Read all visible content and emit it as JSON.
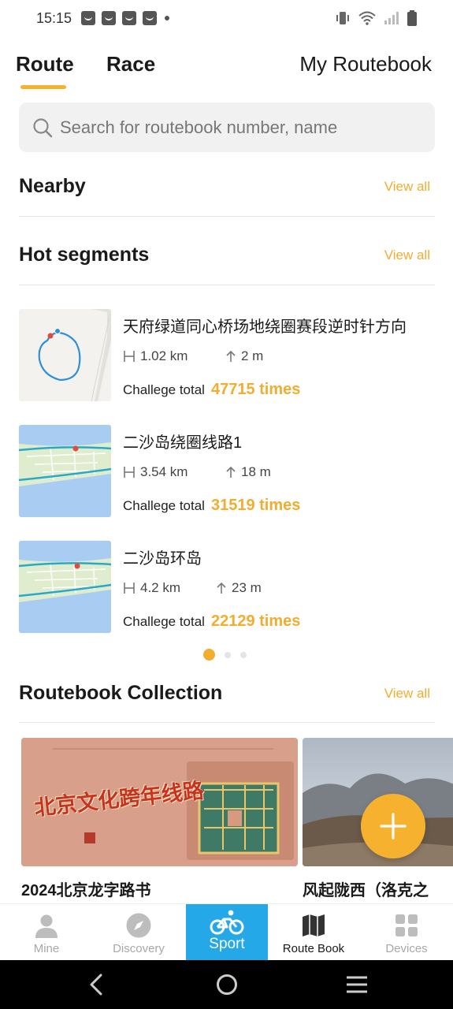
{
  "status_bar": {
    "time": "15:15",
    "notification_icons": [
      "bag-icon",
      "bag-icon",
      "bag-icon",
      "bag-icon"
    ],
    "icons": [
      "vibrate-icon",
      "wifi-icon",
      "signal-icon",
      "battery-icon"
    ]
  },
  "tabs": {
    "route": "Route",
    "race": "Race",
    "my_routebook": "My Routebook",
    "active": "Route"
  },
  "search": {
    "placeholder": "Search for routebook number, name"
  },
  "nearby": {
    "title": "Nearby",
    "view_all": "View all"
  },
  "hot_segments": {
    "title": "Hot segments",
    "view_all": "View all",
    "items": [
      {
        "name": "天府绿道同心桥场地绕圈赛段逆时针方向",
        "distance": "1.02 km",
        "climb": "2 m",
        "challenge_label": "Challege total",
        "challenge_value": "47715 times"
      },
      {
        "name": "二沙岛绕圈线路1",
        "distance": "3.54 km",
        "climb": "18 m",
        "challenge_label": "Challege total",
        "challenge_value": "31519 times"
      },
      {
        "name": "二沙岛环岛",
        "distance": "4.2 km",
        "climb": "23 m",
        "challenge_label": "Challege total",
        "challenge_value": "22129 times"
      }
    ],
    "pager": {
      "count": 3,
      "active": 1
    }
  },
  "routebook_collection": {
    "title": "Routebook Collection",
    "view_all": "View all",
    "cards": [
      {
        "title": "2024北京龙字路书",
        "banner_text": "北京文化跨年线路"
      },
      {
        "title": "风起陇西（洛克之"
      }
    ]
  },
  "fab": {
    "icon": "plus-icon"
  },
  "bottom_nav": {
    "items": [
      {
        "label": "Mine",
        "icon": "person-icon"
      },
      {
        "label": "Discovery",
        "icon": "compass-icon"
      },
      {
        "label": "Sport",
        "icon": "bicycle-icon"
      },
      {
        "label": "Route Book",
        "icon": "map-icon"
      },
      {
        "label": "Devices",
        "icon": "grid-icon"
      }
    ],
    "active": "Sport"
  },
  "colors": {
    "accent": "#f3ad2e",
    "sport_tab": "#24a8e8"
  }
}
